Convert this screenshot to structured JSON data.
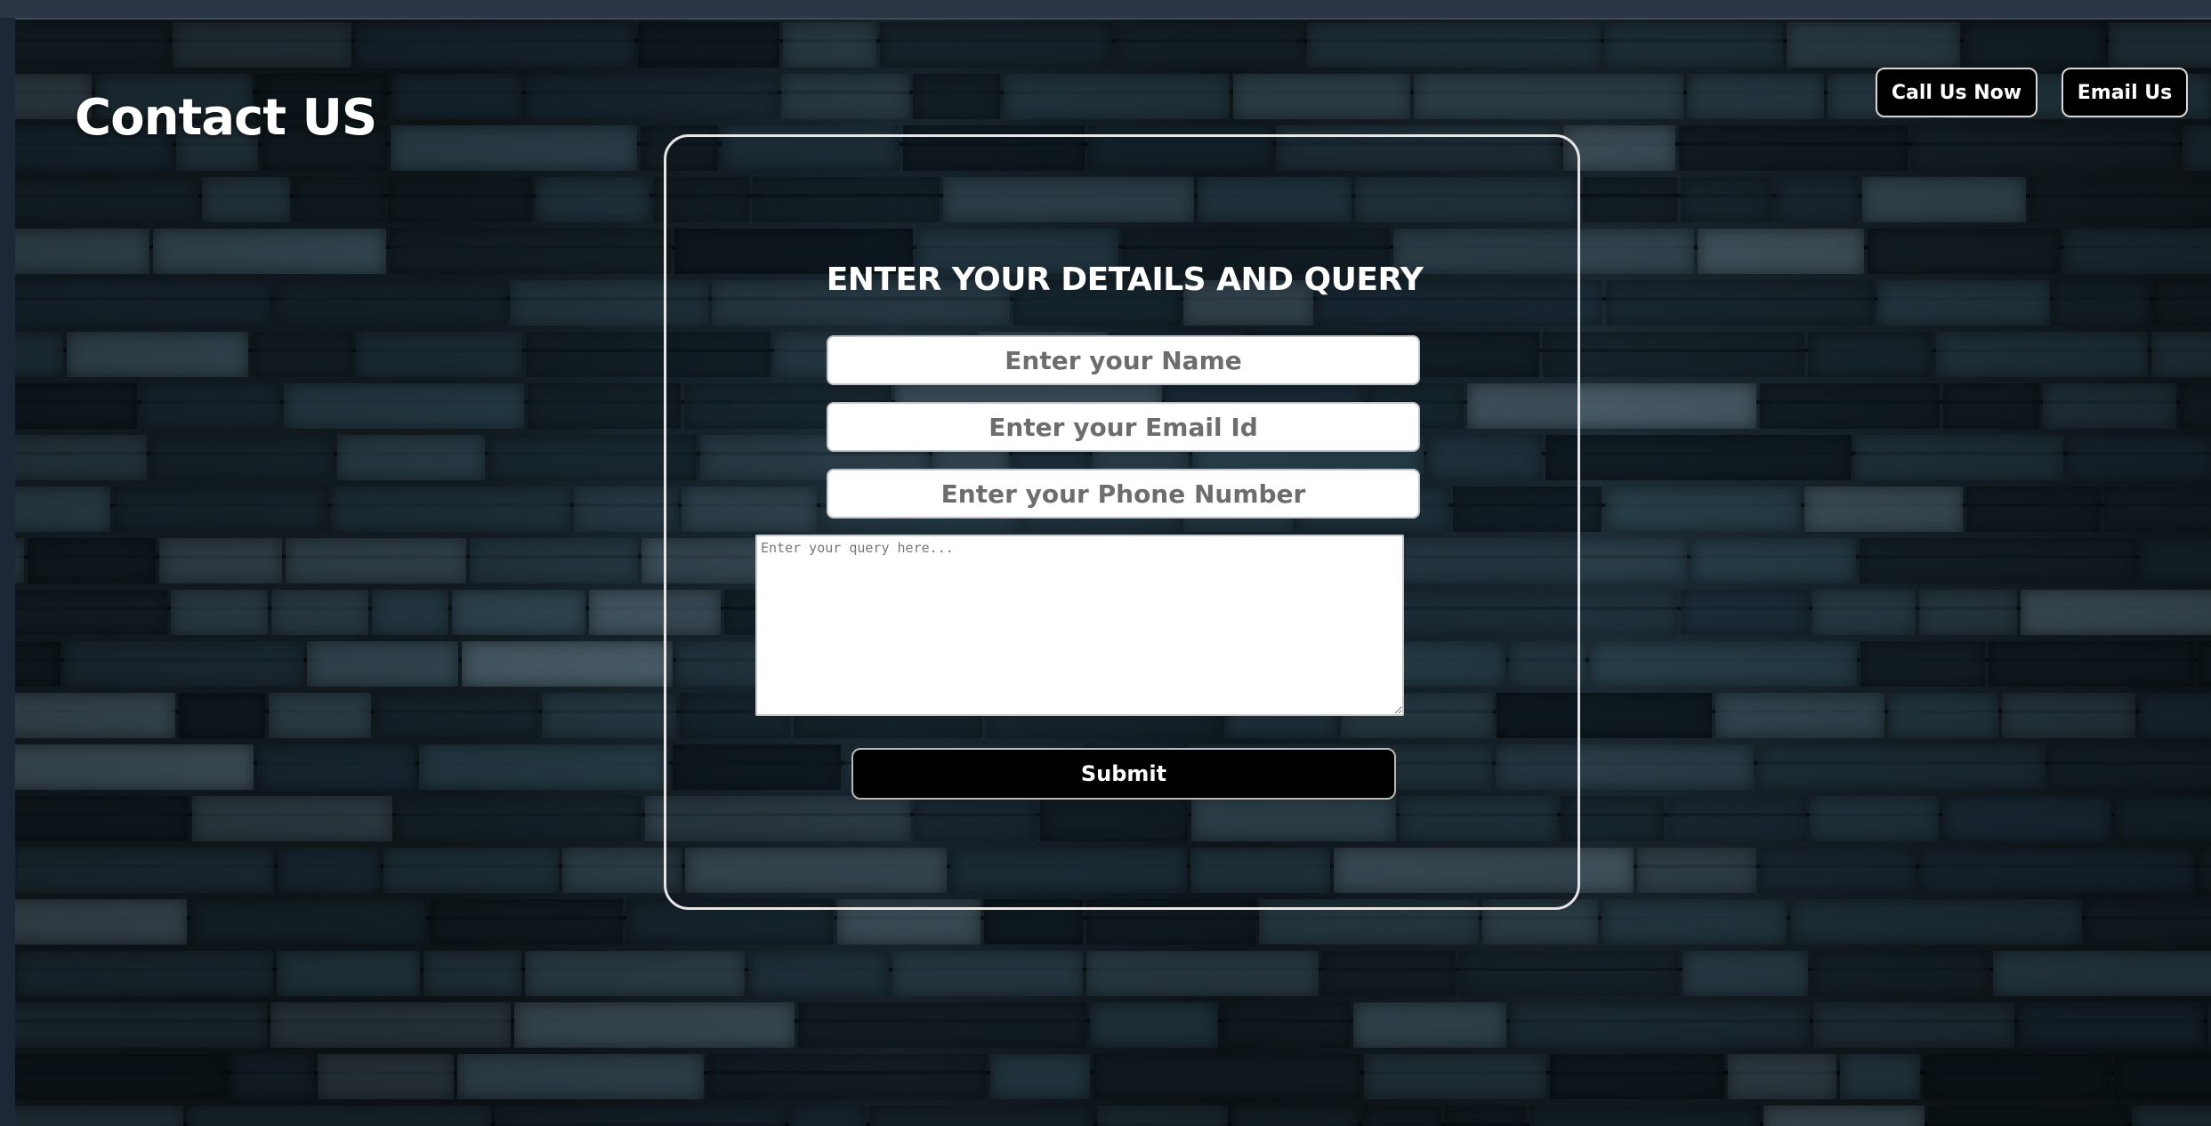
{
  "header": {
    "title": "Contact US",
    "call_label": "Call Us Now",
    "email_label": "Email Us"
  },
  "form": {
    "heading": "ENTER YOUR DETAILS AND QUERY",
    "name_placeholder": "Enter your Name",
    "email_placeholder": "Enter your Email Id",
    "phone_placeholder": "Enter your Phone Number",
    "query_placeholder": "Enter your query here...",
    "submit_label": "Submit"
  },
  "colors": {
    "page_background": "#1f2c3d",
    "button_background": "#000000",
    "text": "#ffffff"
  }
}
